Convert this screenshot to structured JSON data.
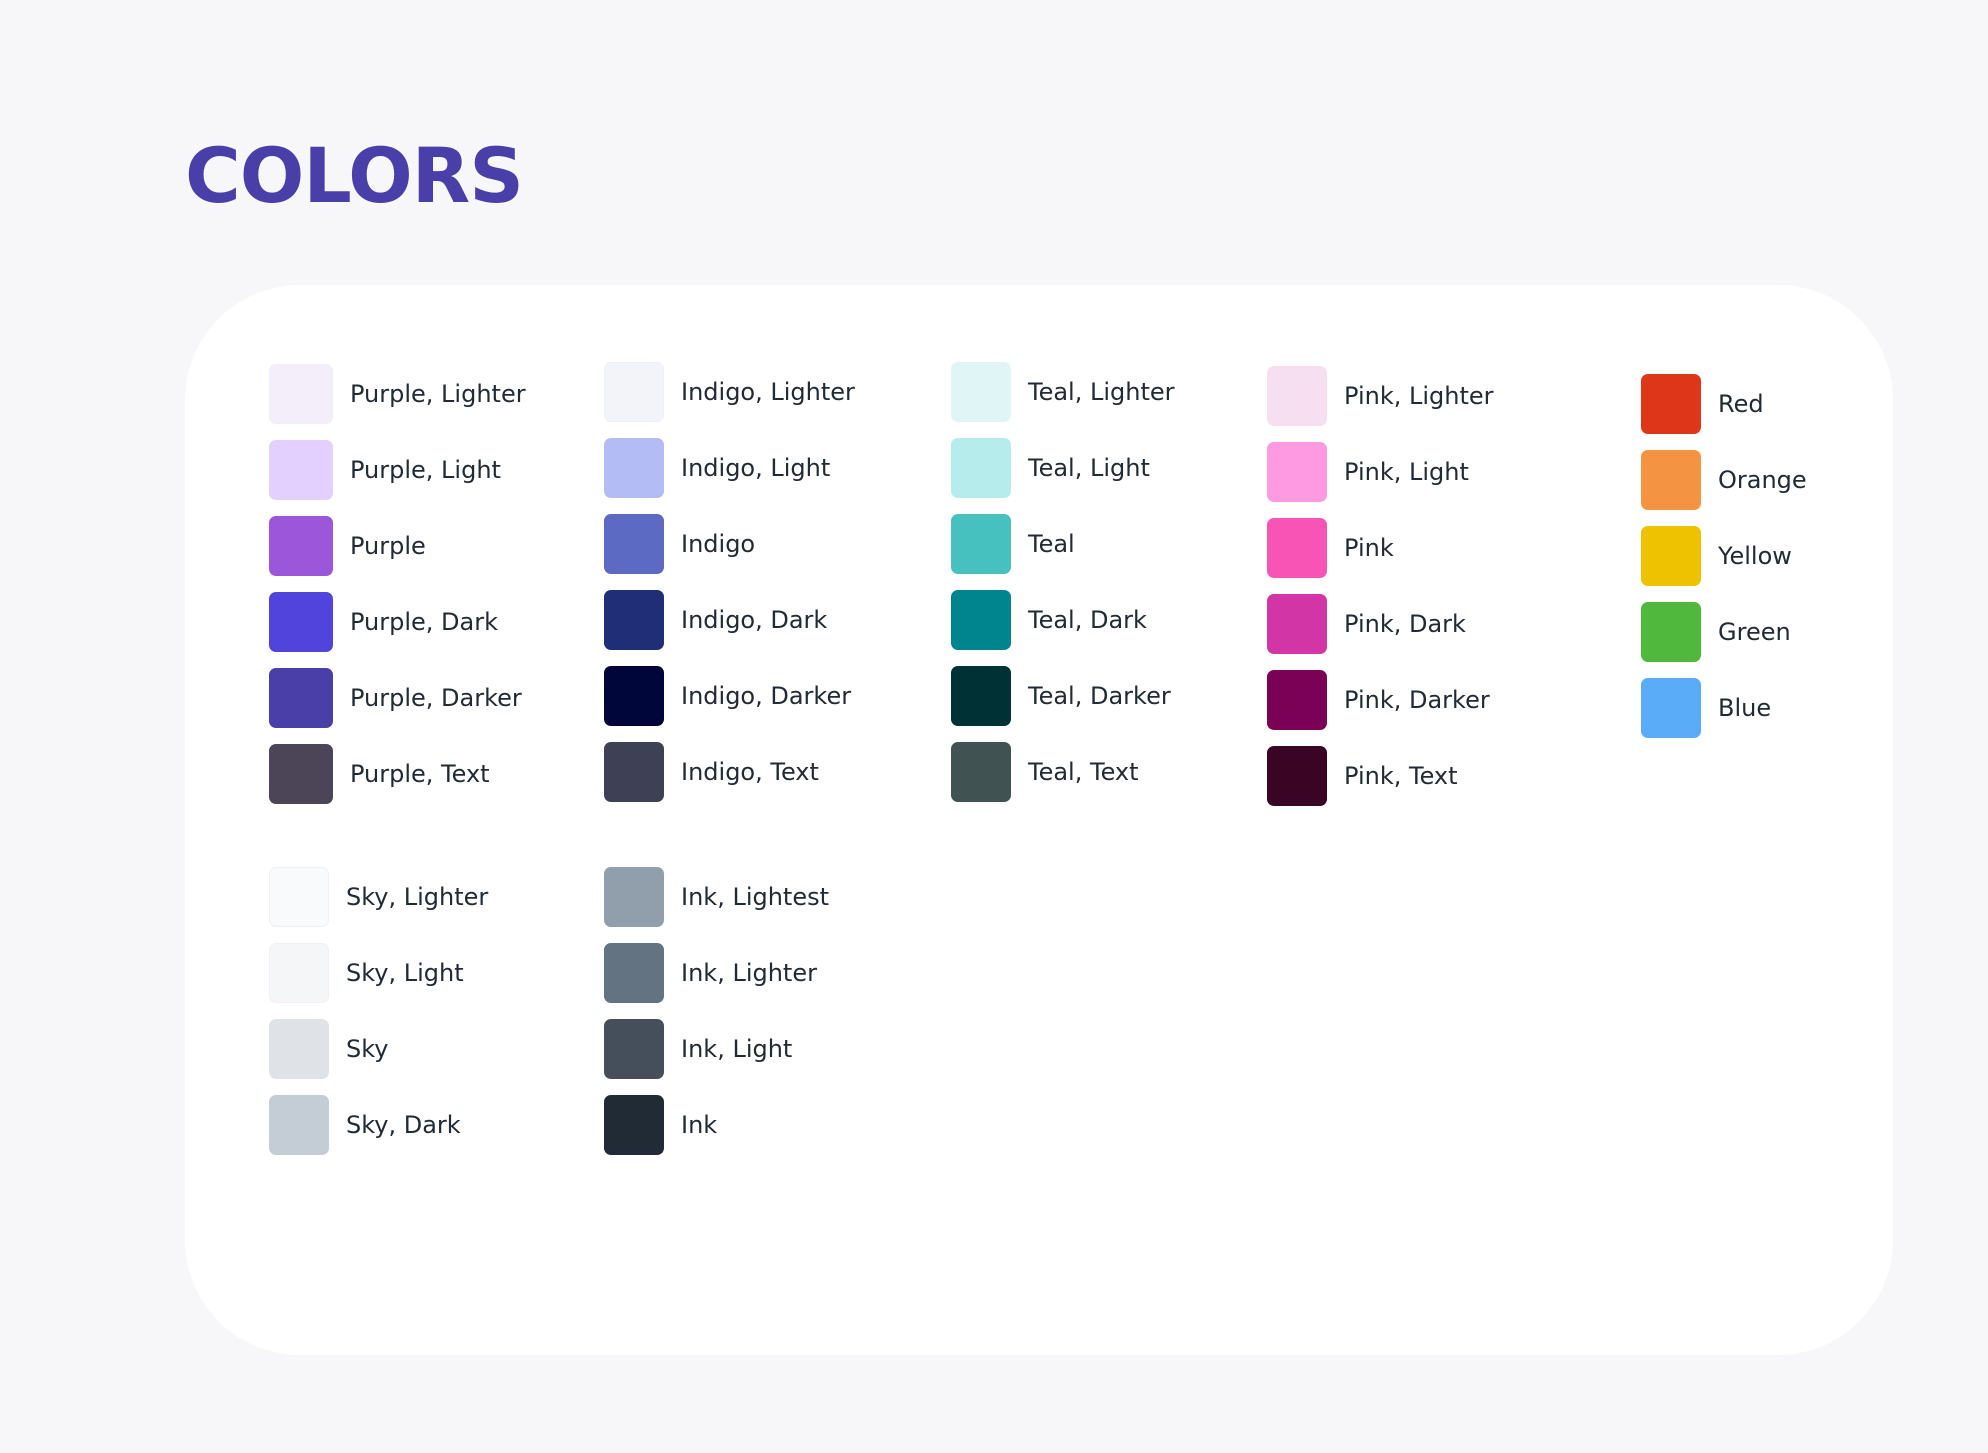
{
  "title": "COLORS",
  "groups": {
    "purple": [
      {
        "label": "Purple, Lighter",
        "color": "#f4eefb"
      },
      {
        "label": "Purple, Light",
        "color": "#e3d0fe"
      },
      {
        "label": "Purple",
        "color": "#9c56d9"
      },
      {
        "label": "Purple, Dark",
        "color": "#5044dc"
      },
      {
        "label": "Purple, Darker",
        "color": "#4a3fa8"
      },
      {
        "label": "Purple, Text",
        "color": "#4b4557"
      }
    ],
    "indigo": [
      {
        "label": "Indigo, Lighter",
        "color": "#f3f4fa"
      },
      {
        "label": "Indigo, Light",
        "color": "#b3bcf5"
      },
      {
        "label": "Indigo",
        "color": "#5c6ac4"
      },
      {
        "label": "Indigo, Dark",
        "color": "#202e78"
      },
      {
        "label": "Indigo, Darker",
        "color": "#000639"
      },
      {
        "label": "Indigo, Text",
        "color": "#3e4155"
      }
    ],
    "teal": [
      {
        "label": "Teal, Lighter",
        "color": "#e0f5f5"
      },
      {
        "label": "Teal, Light",
        "color": "#b7ecec"
      },
      {
        "label": "Teal",
        "color": "#47c1bf"
      },
      {
        "label": "Teal, Dark",
        "color": "#00848e"
      },
      {
        "label": "Teal, Darker",
        "color": "#003135"
      },
      {
        "label": "Teal, Text",
        "color": "#405352"
      }
    ],
    "pink": [
      {
        "label": "Pink, Lighter",
        "color": "#f5dff0"
      },
      {
        "label": "Pink, Light",
        "color": "#fe9ae1"
      },
      {
        "label": "Pink",
        "color": "#f854b5"
      },
      {
        "label": "Pink, Dark",
        "color": "#d235a5"
      },
      {
        "label": "Pink, Darker",
        "color": "#7b0157"
      },
      {
        "label": "Pink, Text",
        "color": "#3a0425"
      }
    ],
    "base": [
      {
        "label": "Red",
        "color": "#de3618"
      },
      {
        "label": "Orange",
        "color": "#f49342"
      },
      {
        "label": "Yellow",
        "color": "#eec200"
      },
      {
        "label": "Green",
        "color": "#50b83c"
      },
      {
        "label": "Blue",
        "color": "#5aabf8"
      }
    ],
    "sky": [
      {
        "label": "Sky, Lighter",
        "color": "#f9fafb"
      },
      {
        "label": "Sky, Light",
        "color": "#f4f6f8"
      },
      {
        "label": "Sky",
        "color": "#dfe3e8"
      },
      {
        "label": "Sky, Dark",
        "color": "#c4cdd5"
      }
    ],
    "ink": [
      {
        "label": "Ink, Lightest",
        "color": "#919eab"
      },
      {
        "label": "Ink, Lighter",
        "color": "#637381"
      },
      {
        "label": "Ink, Light",
        "color": "#454f5b"
      },
      {
        "label": "Ink",
        "color": "#212b36"
      }
    ]
  }
}
